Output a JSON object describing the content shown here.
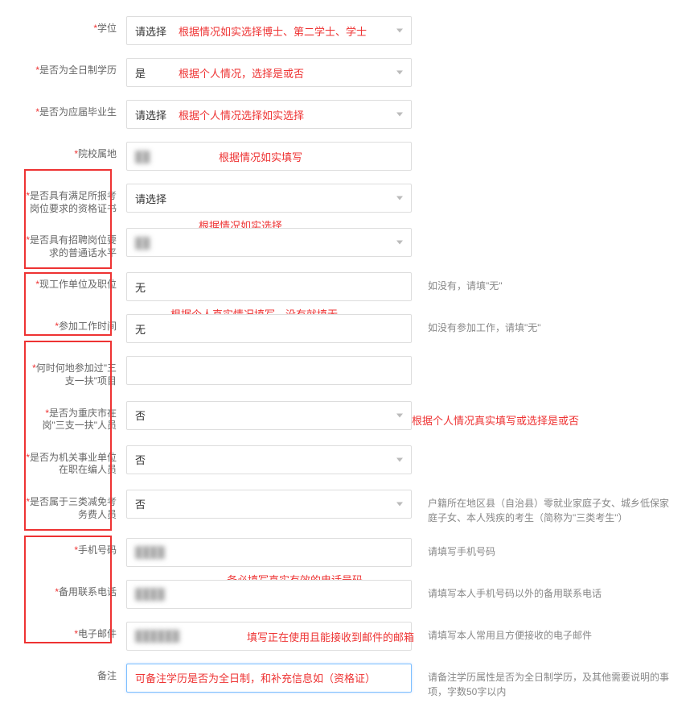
{
  "rows": {
    "degree": {
      "label": "学位",
      "value": "请选择",
      "annot": "根据情况如实选择博士、第二学士、学士"
    },
    "fulltime": {
      "label": "是否为全日制学历",
      "value": "是",
      "annot": "根据个人情况，选择是或否"
    },
    "freshgrad": {
      "label": "是否为应届毕业生",
      "value": "请选择",
      "annot": "根据个人情况选择如实选择"
    },
    "school": {
      "label": "院校属地",
      "value": "██",
      "annot": "根据情况如实填写"
    },
    "qualcert": {
      "label": "是否具有满足所报考岗位要求的资格证书",
      "value": "请选择",
      "annot": "根据情况如实选择"
    },
    "mandarin": {
      "label": "是否具有招聘岗位要求的普通话水平",
      "value": "██"
    },
    "workunit": {
      "label": "现工作单位及职位",
      "value": "无",
      "hint": "如没有，请填\"无\"",
      "annot": "根据个人真实情况填写，没有就填无"
    },
    "worktime": {
      "label": "参加工作时间",
      "value": "无",
      "hint": "如没有参加工作，请填\"无\""
    },
    "sanzhi_when": {
      "label": "何时何地参加过\"三支一扶\"项目",
      "value": ""
    },
    "sanzhi_cq": {
      "label": "是否为重庆市在岗\"三支一扶\"人员",
      "value": "否",
      "annot": "根据个人情况真实填写或选择是或否"
    },
    "gov_staff": {
      "label": "是否为机关事业单位在职在编人员",
      "value": "否"
    },
    "fee_exempt": {
      "label": "是否属于三类减免考务费人员",
      "value": "否",
      "hint": "户籍所在地区县（自治县）零就业家庭子女、城乡低保家庭子女、本人残疾的考生（简称为\"三类考生\"）"
    },
    "phone": {
      "label": "手机号码",
      "value": "████",
      "hint": "请填写手机号码",
      "annot": "务必填写真实有效的电话号码"
    },
    "backup_phone": {
      "label": "备用联系电话",
      "value": "████",
      "hint": "请填写本人手机号码以外的备用联系电话"
    },
    "email": {
      "label": "电子邮件",
      "value": "██████",
      "hint": "请填写本人常用且方便接收的电子邮件",
      "annot": "填写正在使用且能接收到邮件的邮箱"
    },
    "remark": {
      "label": "备注",
      "placeholder": "可备注学历是否为全日制，和补充信息如（资格证）",
      "hint": "请备注学历属性是否为全日制学历，及其他需要说明的事项，字数50字以内"
    }
  }
}
